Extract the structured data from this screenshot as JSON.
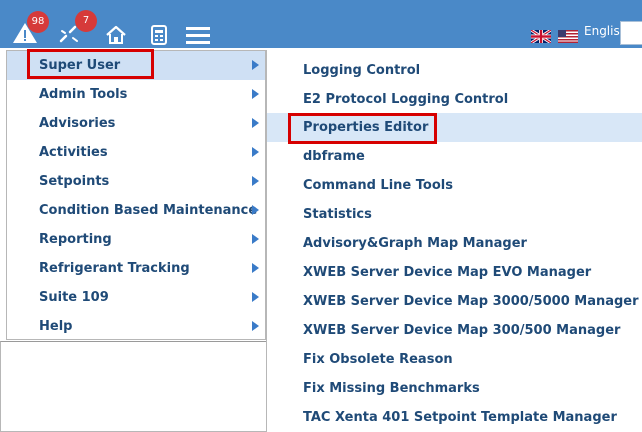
{
  "topbar": {
    "alarm_badge": "98",
    "link_badge": "7",
    "language_label": "English"
  },
  "menu": {
    "items": [
      {
        "label": "Super User",
        "selected": true
      },
      {
        "label": "Admin Tools"
      },
      {
        "label": "Advisories"
      },
      {
        "label": "Activities"
      },
      {
        "label": "Setpoints"
      },
      {
        "label": "Condition Based Maintenance"
      },
      {
        "label": "Reporting"
      },
      {
        "label": "Refrigerant Tracking"
      },
      {
        "label": "Suite 109"
      },
      {
        "label": "Help"
      }
    ]
  },
  "submenu": {
    "items": [
      {
        "label": "Logging Control"
      },
      {
        "label": "E2 Protocol Logging Control"
      },
      {
        "label": "Properties Editor",
        "highlighted": true
      },
      {
        "label": "dbframe"
      },
      {
        "label": "Command Line Tools"
      },
      {
        "label": "Statistics"
      },
      {
        "label": "Advisory&Graph Map Manager"
      },
      {
        "label": "XWEB Server Device Map EVO Manager"
      },
      {
        "label": "XWEB Server Device Map 3000/5000 Manager"
      },
      {
        "label": "XWEB Server Device Map 300/500 Manager"
      },
      {
        "label": "Fix Obsolete Reason"
      },
      {
        "label": "Fix Missing Benchmarks"
      },
      {
        "label": "TAC Xenta 401 Setpoint Template Manager"
      }
    ]
  },
  "colors": {
    "topbar": "#4a89c8",
    "menu_text": "#1f4a77",
    "selection_bg": "#cfe0f4",
    "annotation_red": "#d60000"
  }
}
